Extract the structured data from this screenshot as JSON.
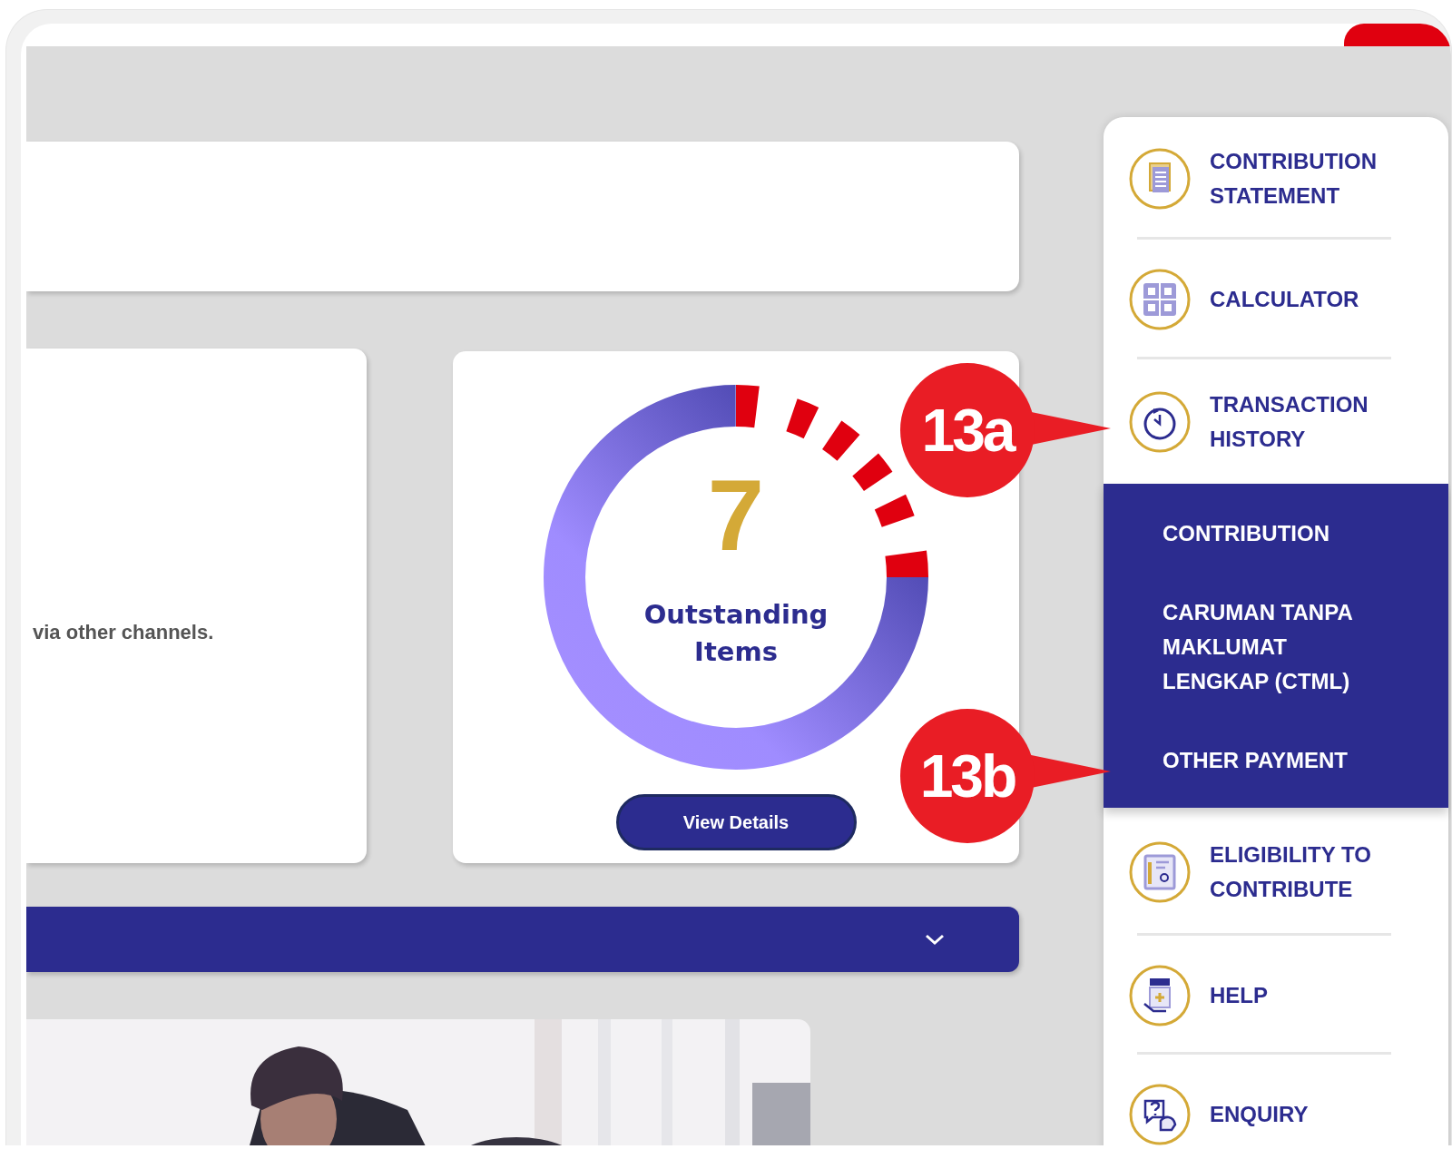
{
  "main": {
    "notice_text": "via other channels.",
    "outstanding": {
      "count": "7",
      "label": "Outstanding Items",
      "button": "View Details"
    },
    "section_bar": {
      "expanded": false
    }
  },
  "sidebar": {
    "items": [
      {
        "kind": "statement",
        "label": "CONTRIBUTION STATEMENT",
        "expanded": false
      },
      {
        "kind": "calculator",
        "label": "CALCULATOR",
        "expanded": false
      },
      {
        "kind": "history",
        "label": "TRANSACTION HISTORY",
        "expanded": true,
        "children": [
          {
            "label": "CONTRIBUTION"
          },
          {
            "label": "CARUMAN TANPA MAKLUMAT LENGKAP (CTML)"
          },
          {
            "label": "OTHER PAYMENT"
          }
        ]
      },
      {
        "kind": "eligibility",
        "label": "ELIGIBILITY TO CONTRIBUTE",
        "expanded": false
      },
      {
        "kind": "help",
        "label": "HELP",
        "expanded": false
      },
      {
        "kind": "enquiry",
        "label": "ENQUIRY",
        "expanded": false
      }
    ]
  },
  "callouts": [
    {
      "label": "13a"
    },
    {
      "label": "13b"
    }
  ]
}
